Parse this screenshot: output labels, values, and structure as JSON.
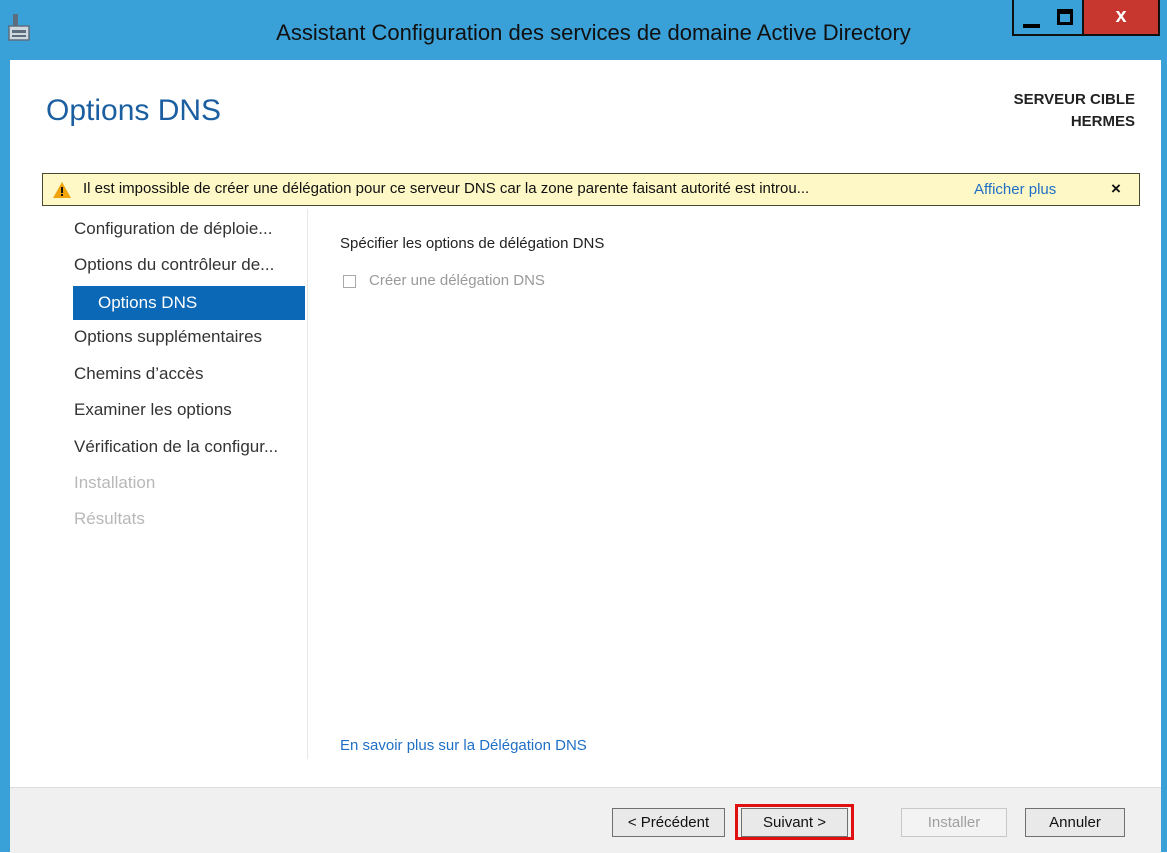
{
  "window": {
    "title": "Assistant Configuration des services de domaine Active Directory",
    "controls": {
      "close_glyph": "x"
    }
  },
  "header": {
    "page_title": "Options DNS",
    "server_line1": "SERVEUR CIBLE",
    "server_line2": "HERMES"
  },
  "warning": {
    "text": "Il est impossible de créer une délégation pour ce serveur DNS car la zone parente faisant autorité est introu...",
    "more_link": "Afficher plus",
    "close_glyph": "×"
  },
  "nav": {
    "items": [
      {
        "label": "Configuration de déploie...",
        "state": "normal"
      },
      {
        "label": "Options du contrôleur de...",
        "state": "normal"
      },
      {
        "label": "Options DNS",
        "state": "active"
      },
      {
        "label": "Options supplémentaires",
        "state": "normal"
      },
      {
        "label": "Chemins d’accès",
        "state": "normal"
      },
      {
        "label": "Examiner les options",
        "state": "normal"
      },
      {
        "label": "Vérification de la configur...",
        "state": "normal"
      },
      {
        "label": "Installation",
        "state": "disabled"
      },
      {
        "label": "Résultats",
        "state": "disabled"
      }
    ]
  },
  "main": {
    "section_title": "Spécifier les options de délégation DNS",
    "checkbox_label": "Créer une délégation DNS",
    "checkbox_checked": false,
    "learn_more": "En savoir plus sur la Délégation DNS"
  },
  "footer": {
    "previous": "< Précédent",
    "next": "Suivant >",
    "install": "Installer",
    "cancel": "Annuler"
  },
  "colors": {
    "title_bar": "#3aa0d8",
    "accent": "#0b68b6",
    "warning_bg": "#fdf8c6",
    "highlight": "#e01010"
  }
}
